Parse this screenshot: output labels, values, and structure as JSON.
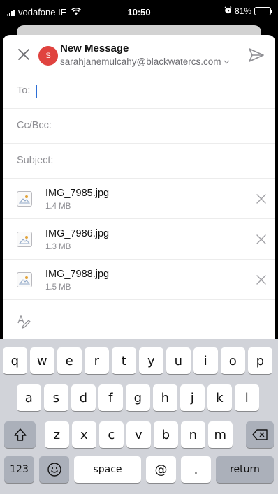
{
  "status_bar": {
    "carrier": "vodafone IE",
    "time": "10:50",
    "battery_text": "81%",
    "battery_level": 0.81
  },
  "compose": {
    "title": "New Message",
    "avatar_initial": "S",
    "account": "sarahjanemulcahy@blackwatercs.com",
    "fields": {
      "to_label": "To:",
      "to_value": "",
      "cc_label": "Cc/Bcc:",
      "subject_label": "Subject:",
      "subject_value": ""
    },
    "attachments": [
      {
        "name": "IMG_7985.jpg",
        "size": "1.4 MB"
      },
      {
        "name": "IMG_7986.jpg",
        "size": "1.3 MB"
      },
      {
        "name": "IMG_7988.jpg",
        "size": "1.5 MB"
      }
    ]
  },
  "keyboard": {
    "row1": [
      "q",
      "w",
      "e",
      "r",
      "t",
      "y",
      "u",
      "i",
      "o",
      "p"
    ],
    "row2": [
      "a",
      "s",
      "d",
      "f",
      "g",
      "h",
      "j",
      "k",
      "l"
    ],
    "row3": [
      "z",
      "x",
      "c",
      "v",
      "b",
      "n",
      "m"
    ],
    "numbers_key": "123",
    "space_key": "space",
    "at_key": "@",
    "period_key": ".",
    "return_key": "return"
  },
  "colors": {
    "accent": "#2d6fd6",
    "avatar": "#e0433f"
  },
  "icons": {
    "close": "close-icon",
    "send": "send-icon",
    "attachment": "image-file-icon",
    "remove": "remove-icon",
    "format": "format-text-icon",
    "shift": "shift-icon",
    "backspace": "backspace-icon",
    "emoji": "emoji-icon"
  }
}
